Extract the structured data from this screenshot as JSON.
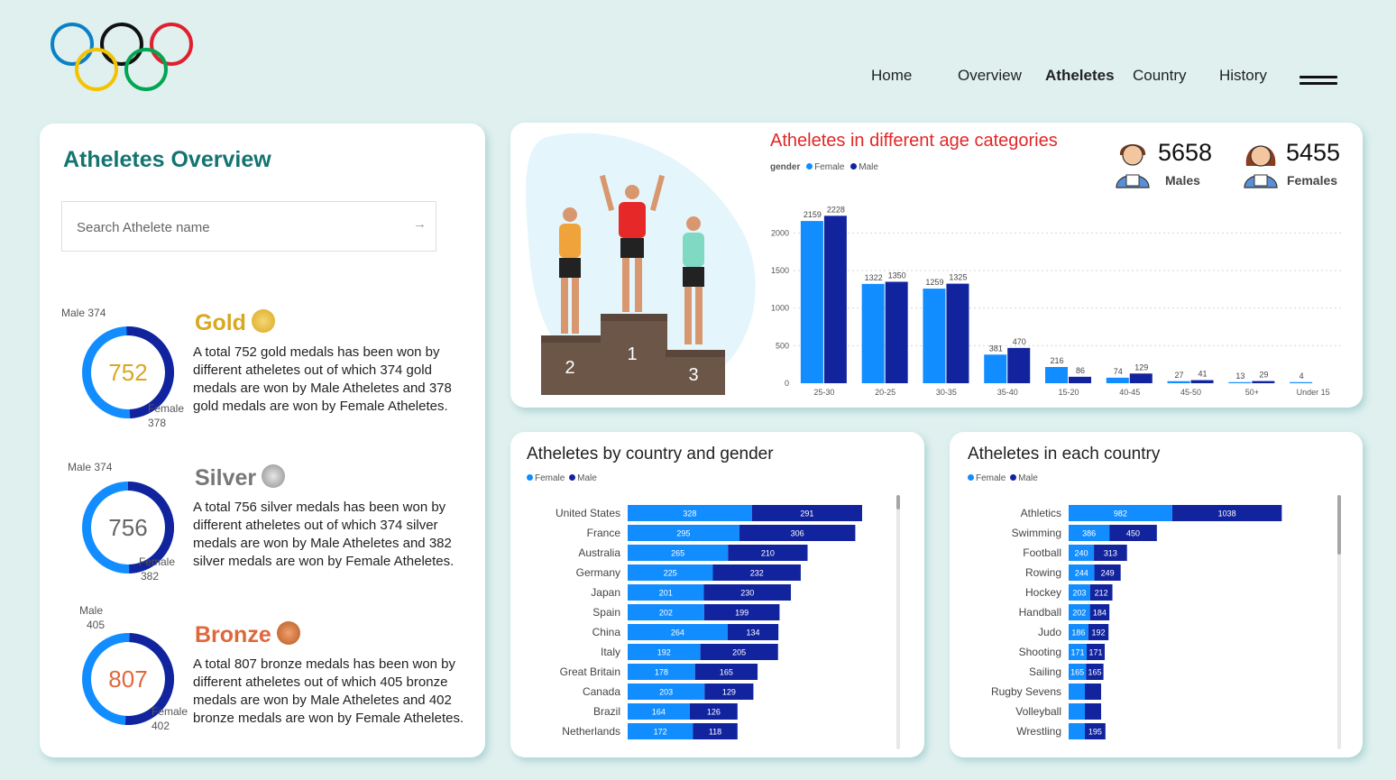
{
  "nav": {
    "home": "Home",
    "overview": "Overview",
    "athletes": "Atheletes",
    "country": "Country",
    "history": "History"
  },
  "colors": {
    "female": "#118dff",
    "male": "#12239e",
    "gold": "#d9a820",
    "silver": "#777777",
    "bronze": "#e0673a",
    "title_teal": "#137470",
    "age_title": "#e22726"
  },
  "overview": {
    "title": "Atheletes Overview",
    "search_placeholder": "Search Athelete name",
    "medals": [
      {
        "name": "Gold",
        "total": "752",
        "male_label": "Male 374",
        "female_label": "Female",
        "female_value": "378",
        "description": "A total 752 gold medals has been won by different atheletes out of which 374 gold medals are won by Male Atheletes and 378 gold medals are won by Female Atheletes."
      },
      {
        "name": "Silver",
        "total": "756",
        "male_label": "Male 374",
        "female_label": "Female",
        "female_value": "382",
        "description": "A total 756 silver medals has been won by different atheletes out of which 374 silver medals are won by Male Atheletes and 382 silver medals are won by Female Atheletes."
      },
      {
        "name": "Bronze",
        "total": "807",
        "male_label": "Male",
        "male_value": "405",
        "female_label": "Female",
        "female_value": "402",
        "description": "A total 807 bronze medals has been won by different atheletes out of which 405 bronze medals are won by Male Atheletes and 402 bronze medals are won by Female Atheletes."
      }
    ]
  },
  "stats": {
    "males_value": "5658",
    "males_label": "Males",
    "females_value": "5455",
    "females_label": "Females"
  },
  "podium": {
    "p2": "2",
    "p1": "1",
    "p3": "3"
  },
  "chart_data": [
    {
      "type": "bar",
      "title": "Atheletes in different age categories",
      "legend_title": "gender",
      "categories": [
        "25-30",
        "20-25",
        "30-35",
        "35-40",
        "15-20",
        "40-45",
        "45-50",
        "50+",
        "Under 15"
      ],
      "series": [
        {
          "name": "Female",
          "values": [
            2159,
            1322,
            1259,
            381,
            216,
            74,
            27,
            13,
            4
          ]
        },
        {
          "name": "Male",
          "values": [
            2228,
            1350,
            1325,
            470,
            86,
            129,
            41,
            29,
            null
          ]
        }
      ],
      "yticks": [
        0,
        500,
        1000,
        1500,
        2000
      ],
      "ylim": [
        0,
        2400
      ],
      "grid": true
    },
    {
      "type": "bar",
      "orientation": "horizontal-stacked",
      "title": "Atheletes by country and gender",
      "categories": [
        "United States",
        "France",
        "Australia",
        "Germany",
        "Japan",
        "Spain",
        "China",
        "Italy",
        "Great Britain",
        "Canada",
        "Brazil",
        "Netherlands"
      ],
      "series": [
        {
          "name": "Female",
          "values": [
            328,
            295,
            265,
            225,
            201,
            202,
            264,
            192,
            178,
            203,
            164,
            172
          ]
        },
        {
          "name": "Male",
          "values": [
            291,
            306,
            210,
            232,
            230,
            199,
            134,
            205,
            165,
            129,
            126,
            118
          ]
        }
      ]
    },
    {
      "type": "bar",
      "orientation": "horizontal-stacked",
      "title": "Atheletes in each country",
      "categories": [
        "Athletics",
        "Swimming",
        "Football",
        "Rowing",
        "Hockey",
        "Handball",
        "Judo",
        "Shooting",
        "Sailing",
        "Rugby Sevens",
        "Volleyball",
        "Wrestling"
      ],
      "series": [
        {
          "name": "Female",
          "values": [
            982,
            386,
            240,
            244,
            203,
            202,
            186,
            171,
            165,
            null,
            null,
            null
          ]
        },
        {
          "name": "Male",
          "values": [
            1038,
            450,
            313,
            249,
            212,
            184,
            192,
            171,
            165,
            null,
            null,
            195
          ]
        }
      ]
    }
  ]
}
